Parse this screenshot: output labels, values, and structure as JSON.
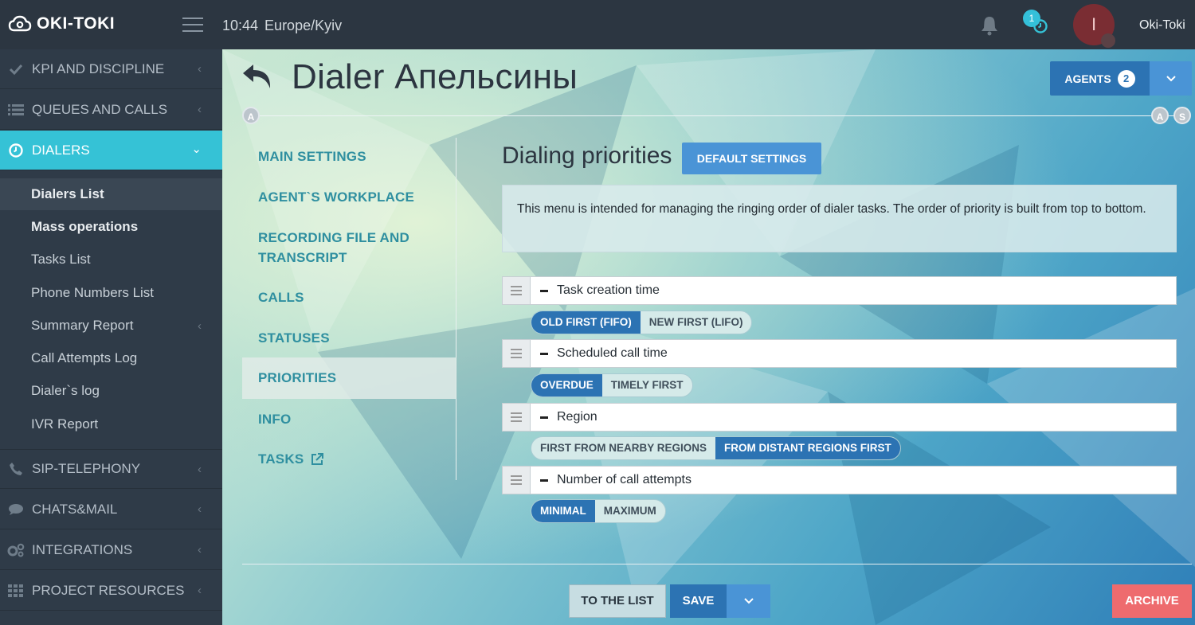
{
  "topbar": {
    "logo": "OKI-TOKI",
    "time": "10:44",
    "timezone": "Europe/Kyiv",
    "notification_count": "1",
    "avatar_initial": "I",
    "username": "Oki-Toki"
  },
  "sidebar": {
    "items": [
      {
        "label": "KPI AND DISCIPLINE",
        "icon": "check-icon"
      },
      {
        "label": "QUEUES AND CALLS",
        "icon": "list-icon"
      },
      {
        "label": "DIALERS",
        "icon": "clock-icon",
        "active": true
      },
      {
        "label": "SIP-TELEPHONY",
        "icon": "phone-icon"
      },
      {
        "label": "CHATS&MAIL",
        "icon": "chat-icon"
      },
      {
        "label": "INTEGRATIONS",
        "icon": "gears-icon"
      },
      {
        "label": "PROJECT RESOURCES",
        "icon": "grid-icon"
      }
    ],
    "dialers_sub": [
      {
        "label": "Dialers List"
      },
      {
        "label": "Mass operations"
      },
      {
        "label": "Tasks List"
      },
      {
        "label": "Phone Numbers List"
      },
      {
        "label": "Summary Report"
      },
      {
        "label": "Call Attempts Log"
      },
      {
        "label": "Dialer`s log"
      },
      {
        "label": "IVR Report"
      }
    ]
  },
  "header": {
    "title": "Dialer Апельсины",
    "agents_label": "AGENTS",
    "agents_count": "2",
    "timeline_start": "A",
    "timeline_end_a": "A",
    "timeline_end_s": "S"
  },
  "menu": {
    "items": [
      {
        "label": "MAIN SETTINGS"
      },
      {
        "label": "AGENT`S WORKPLACE"
      },
      {
        "label": "RECORDING FILE AND TRANSCRIPT"
      },
      {
        "label": "CALLS"
      },
      {
        "label": "STATUSES"
      },
      {
        "label": "PRIORITIES",
        "active": true
      },
      {
        "label": "INFO"
      },
      {
        "label": "TASKS"
      }
    ]
  },
  "priorities": {
    "title": "Dialing priorities",
    "default_button": "DEFAULT SETTINGS",
    "info": "This menu is intended for managing the ringing order of dialer tasks. The order of priority is built from top to bottom.",
    "rows": [
      {
        "label": "Task creation time",
        "options": [
          "OLD FIRST (FIFO)",
          "NEW FIRST (LIFO)"
        ],
        "selected": 0
      },
      {
        "label": "Scheduled call time",
        "options": [
          "OVERDUE",
          "TIMELY FIRST"
        ],
        "selected": 0
      },
      {
        "label": "Region",
        "options": [
          "FIRST FROM NEARBY REGIONS",
          "FROM DISTANT REGIONS FIRST"
        ],
        "selected": 1
      },
      {
        "label": "Number of call attempts",
        "options": [
          "MINIMAL",
          "MAXIMUM"
        ],
        "selected": 0
      }
    ]
  },
  "footer": {
    "to_list": "TO THE LIST",
    "save": "SAVE",
    "archive": "ARCHIVE"
  },
  "colors": {
    "sidebar_bg": "#2f3b48",
    "topbar_bg": "#2c3641",
    "active_nav": "#35c2d6",
    "primary": "#2c73b3",
    "primary_light": "#4a94d6",
    "menu_text": "#2f8fa0",
    "archive": "#ee6b6e"
  }
}
